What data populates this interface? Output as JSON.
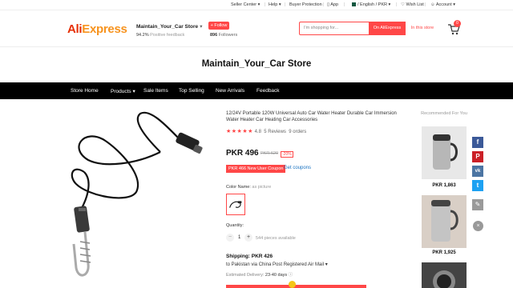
{
  "topbar": {
    "seller_center": "Seller Center",
    "help": "Help",
    "buyer_protection": "Buyer Protection",
    "app": "App",
    "language_currency": "/ English / PKR",
    "wish_list": "Wish List",
    "account": "Account"
  },
  "header": {
    "logo_ali": "Ali",
    "logo_express": "Express",
    "store_name": "Maintain_Your_Car Store",
    "feedback_value": "94.2%",
    "feedback_label": "Positive feedback",
    "follow_label": "+ Follow",
    "followers_value": "896",
    "followers_label": "Followers",
    "search_placeholder": "I'm shopping for...",
    "search_aliexpress": "On AliExpress",
    "search_store": "In this store",
    "cart_count": "0"
  },
  "banner": {
    "title": "Maintain_Your_Car Store"
  },
  "nav": {
    "items": [
      "Store Home",
      "Products",
      "Sale Items",
      "Top Selling",
      "New Arrivals",
      "Feedback"
    ]
  },
  "product": {
    "title": "12/24V Portable 120W Universal Auto Car Water Heater Durable Car Immersion Water Heater Car Heating Car Accessories",
    "rating": "4.8",
    "rating_stars": 4.8,
    "reviews": "5 Reviews",
    "orders": "9 orders",
    "price": "PKR 496",
    "old_price": "PKR 620",
    "discount": "-20%",
    "coupon": "PKR 466 New User Coupon",
    "get_coupons": "Get coupons",
    "color_label": "Color Name:",
    "color_value": "as picture",
    "quantity_label": "Quantity:",
    "quantity": "1",
    "available": "544 pieces available",
    "shipping": "Shipping: PKR 426",
    "ship_dest": "to Pakistan via China Post Registered Air Mail",
    "delivery_label": "Estimated Delivery:",
    "delivery_value": "23-40 days"
  },
  "recommended": {
    "title": "Recommended For You",
    "items": [
      {
        "price": "PKR 1,863"
      },
      {
        "price": "PKR 1,925"
      }
    ]
  },
  "social": {
    "facebook": "f",
    "pinterest": "P",
    "vk": "vk",
    "twitter": "t",
    "edit": "✎",
    "close": "×"
  },
  "colors": {
    "accent": "#ff4747",
    "nav_bg": "#000000",
    "link": "#1a73c2"
  }
}
